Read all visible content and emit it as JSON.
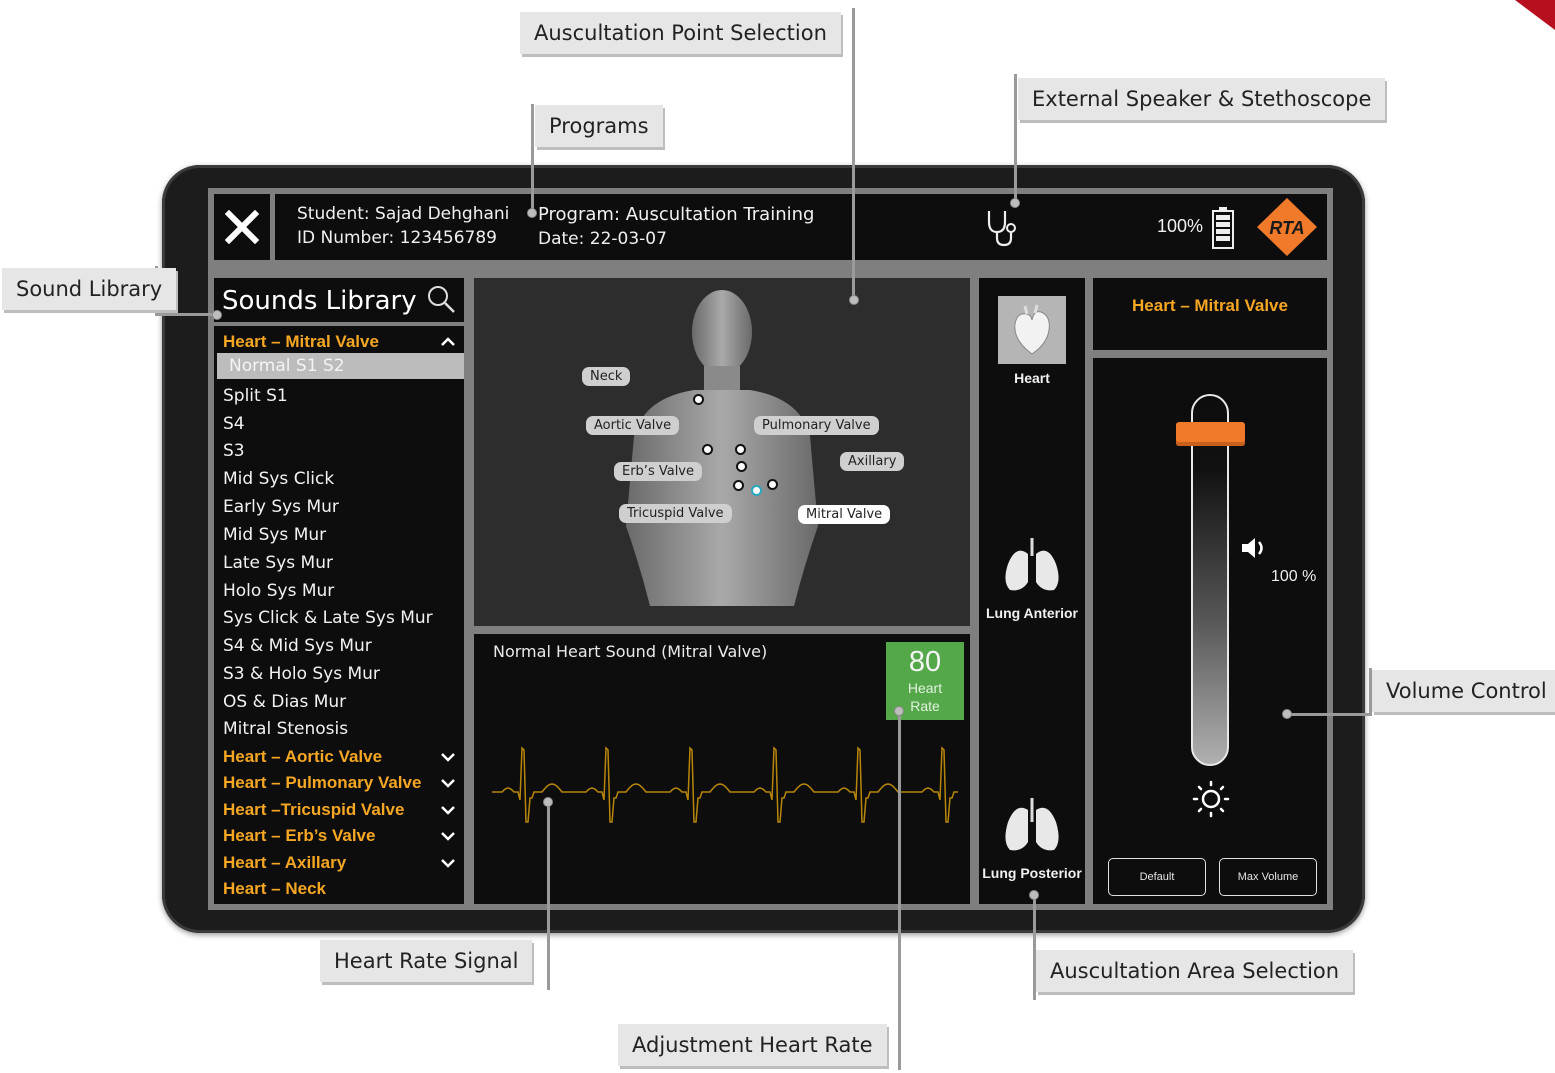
{
  "callouts": {
    "auscultation_point": "Auscultation Point Selection",
    "programs": "Programs",
    "external_speaker": "External Speaker & Stethoscope",
    "sound_library": "Sound Library",
    "volume_control": "Volume Control",
    "heart_rate_signal": "Heart Rate Signal",
    "area_selection": "Auscultation Area Selection",
    "adjust_heart_rate": "Adjustment Heart Rate"
  },
  "header": {
    "student": "Student: Sajad Dehghani",
    "id_number": "ID Number: 123456789",
    "program": "Program: Auscultation Training",
    "date": "Date: 22-03-07",
    "battery": "100%",
    "logo": "RTA"
  },
  "library": {
    "title": "Sounds Library",
    "open_category": "Heart – Mitral Valve",
    "selected_item": "Normal S1 S2",
    "items": [
      "Split S1",
      "S4",
      "S3",
      "Mid Sys Click",
      "Early Sys Mur",
      "Mid Sys Mur",
      "Late Sys Mur",
      "Holo Sys Mur",
      "Sys Click & Late Sys Mur",
      "S4 & Mid Sys Mur",
      "S3 & Holo Sys Mur",
      "OS & Dias Mur",
      "Mitral Stenosis"
    ],
    "categories": [
      "Heart – Aortic Valve",
      "Heart – Pulmonary Valve",
      "Heart –Tricuspid Valve",
      "Heart – Erb’s Valve",
      "Heart – Axillary",
      "Heart – Neck"
    ]
  },
  "points": {
    "neck": "Neck",
    "aortic": "Aortic Valve",
    "pulmonary": "Pulmonary Valve",
    "erbs": "Erb’s Valve",
    "axillary": "Axillary",
    "tricuspid": "Tricuspid Valve",
    "mitral": "Mitral Valve"
  },
  "signal": {
    "title": "Normal Heart Sound (Mitral Valve)",
    "heart_rate": "80",
    "heart_rate_label": "Heart Rate",
    "trace_color": "#b8860b"
  },
  "areas": {
    "heart": "Heart",
    "lung_anterior": "Lung Anterior",
    "lung_posterior": "Lung Posterior"
  },
  "volume": {
    "title": "Heart – Mitral Valve",
    "level_text": "100 %",
    "level": 1.0,
    "default_btn": "Default",
    "max_btn": "Max Volume",
    "accent": "#f07a2a"
  },
  "colors": {
    "category": "#f5a623",
    "hr_box": "#55a84a"
  }
}
